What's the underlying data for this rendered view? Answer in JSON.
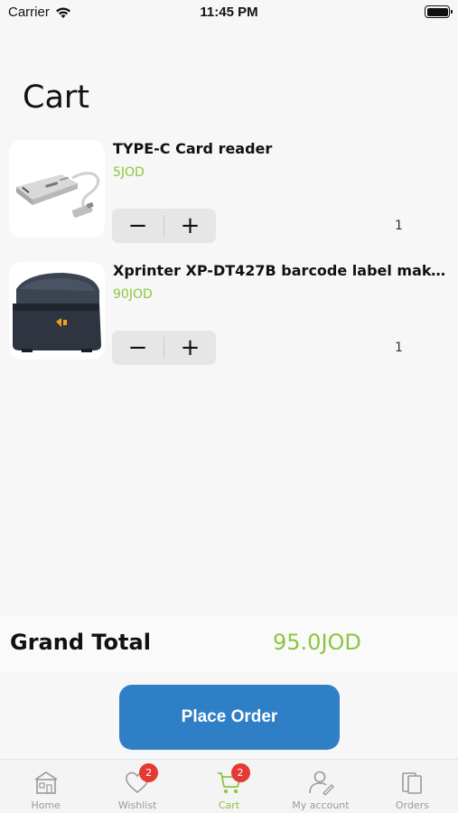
{
  "status_bar": {
    "carrier": "Carrier",
    "time": "11:45 PM"
  },
  "page": {
    "title": "Cart"
  },
  "cart_items": [
    {
      "name": "TYPE-C Card reader",
      "price": "5JOD",
      "quantity": "1",
      "image_icon": "card-reader-image"
    },
    {
      "name": "Xprinter XP-DT427B barcode label maker...",
      "price": "90JOD",
      "quantity": "1",
      "image_icon": "label-printer-image"
    }
  ],
  "stepper": {
    "minus": "−",
    "plus": "+"
  },
  "summary": {
    "grand_total_label": "Grand Total",
    "grand_total_value": "95.0JOD"
  },
  "actions": {
    "place_order": "Place Order"
  },
  "tabs": [
    {
      "label": "Home",
      "icon": "home-icon",
      "badge": ""
    },
    {
      "label": "Wishlist",
      "icon": "heart-icon",
      "badge": "2"
    },
    {
      "label": "Cart",
      "icon": "cart-icon",
      "badge": "2",
      "active": true
    },
    {
      "label": "My account",
      "icon": "account-icon",
      "badge": ""
    },
    {
      "label": "Orders",
      "icon": "orders-icon",
      "badge": ""
    }
  ],
  "colors": {
    "accent_green": "#8cc63f",
    "primary_blue": "#2f7fc7",
    "badge_red": "#e53935"
  }
}
